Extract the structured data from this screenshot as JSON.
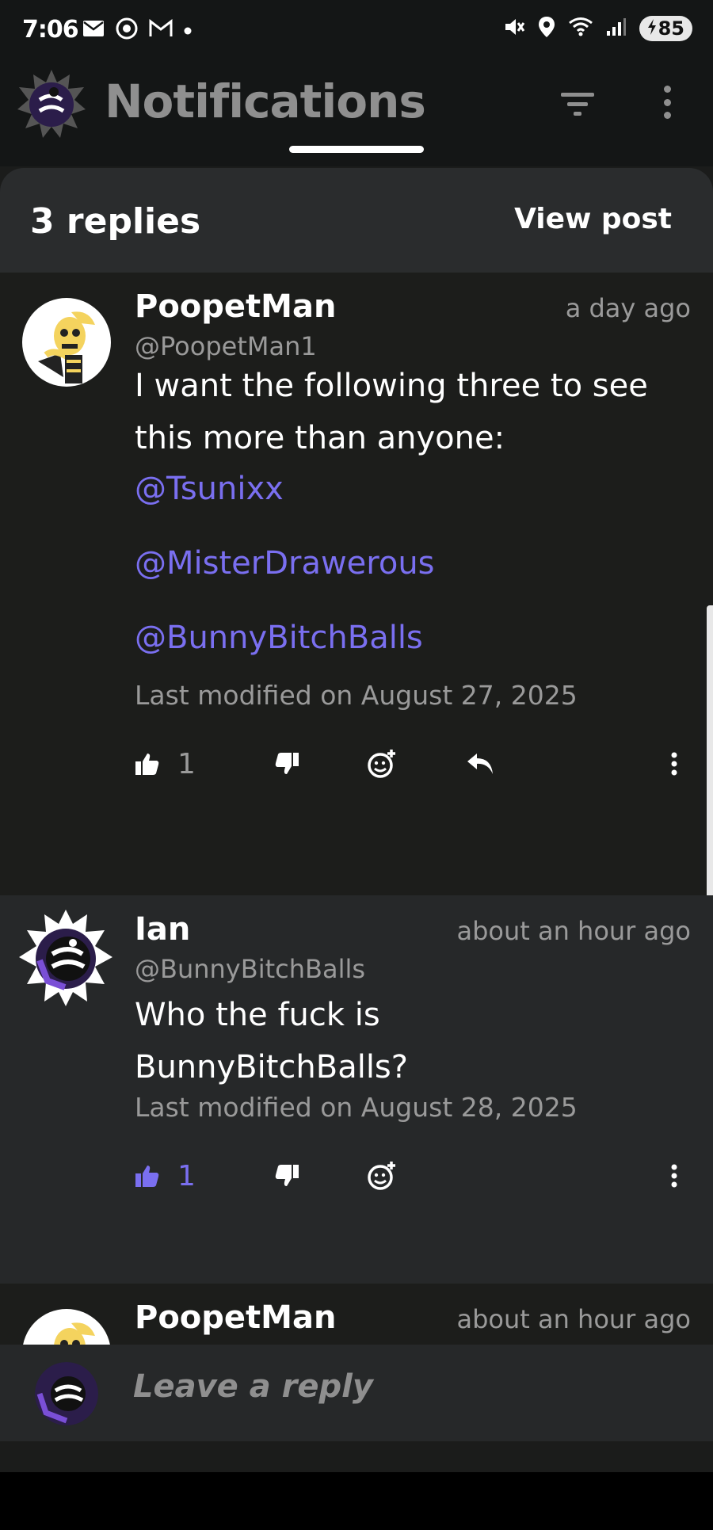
{
  "status_bar": {
    "time": "7:06",
    "battery": "85"
  },
  "app_bar": {
    "title": "Notifications"
  },
  "thread": {
    "replies_label": "3 replies",
    "view_post_label": "View post"
  },
  "comments": [
    {
      "author": "PoopetMan",
      "handle": "@PoopetMan1",
      "time": "a day ago",
      "body_line1": "I want the following three to see",
      "body_line2": "this more than anyone:",
      "mentions": [
        "@Tsunixx",
        "@MisterDrawerous",
        "@BunnyBitchBalls"
      ],
      "modified": "Last modified on August 27, 2025",
      "likes": "1"
    },
    {
      "author": "Ian",
      "handle": "@BunnyBitchBalls",
      "time": "about an hour ago",
      "body_line1": "Who the fuck is",
      "body_line2": "BunnyBitchBalls?",
      "modified": "Last modified on August 28, 2025",
      "likes": "1"
    },
    {
      "author": "PoopetMan",
      "time": "about an hour ago"
    }
  ],
  "reply_bar": {
    "placeholder": "Leave a reply"
  },
  "colors": {
    "accent": "#7a6ff0",
    "background": "#1b1c1b",
    "header": "#2a2c2d"
  }
}
